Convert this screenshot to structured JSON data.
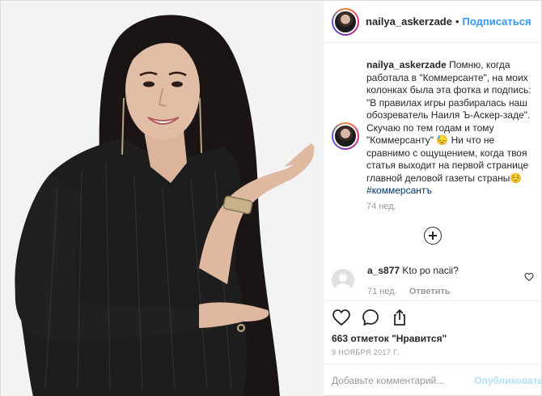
{
  "post": {
    "author": "nailya_askerzade",
    "separator": "•",
    "follow_label": "Подписаться"
  },
  "caption": {
    "username": "nailya_askerzade",
    "text": " Помню, когда работала в \"Коммерсанте\", на моих колонках была эта фотка и подпись: \"В правилах игры разбиралась наш обозреватель Наиля Ъ-Аскер-заде\". Скучаю по тем годам и тому \"Коммерсанту\" 😓 Ни что не сравнимо с ощущением, когда твоя статья выходит на первой странице главной деловой газеты страны☺️ ",
    "hashtag": "#коммерсантъ",
    "time": "74 нед."
  },
  "reply": {
    "username": "a_s877",
    "text": "Kto po nacii?",
    "time": "71 нед.",
    "reply_label": "Ответить"
  },
  "actions": {
    "like_icon": "heart-icon",
    "comment_icon": "comment-icon",
    "share_icon": "share-icon"
  },
  "likes": {
    "count": "663",
    "label": "отметок \"Нравится\""
  },
  "date": "9 НОЯБРЯ 2017 Г.",
  "comment_box": {
    "placeholder": "Добавьте комментарий...",
    "publish_label": "Опубликовать"
  },
  "colors": {
    "link_blue": "#3897f0",
    "hashtag": "#003569",
    "publish_disabled": "#b2dffc",
    "muted": "#999999"
  }
}
